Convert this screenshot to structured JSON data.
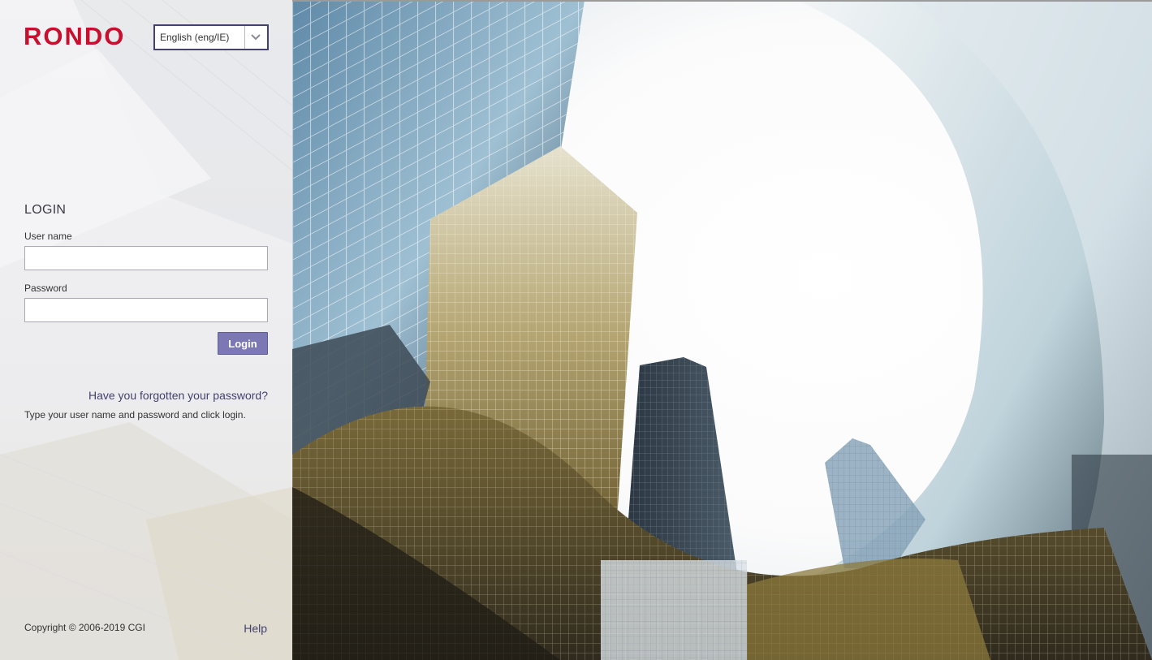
{
  "brand": {
    "logo_text": "RONDO",
    "logo_color": "#c8102e"
  },
  "language": {
    "selected": "English (eng/IE)"
  },
  "login": {
    "title": "LOGIN",
    "username_label": "User name",
    "username_value": "",
    "password_label": "Password",
    "password_value": "",
    "submit_label": "Login",
    "forgot_link": "Have you forgotten your password?",
    "hint": "Type your user name and password and click login."
  },
  "footer": {
    "copyright": "Copyright © 2006-2019 CGI",
    "help": "Help"
  },
  "colors": {
    "accent": "#7b78b3",
    "link": "#43416e",
    "panel_bg": "#eeeeef"
  },
  "hero": {
    "image": "city-skyscrapers-photo"
  }
}
